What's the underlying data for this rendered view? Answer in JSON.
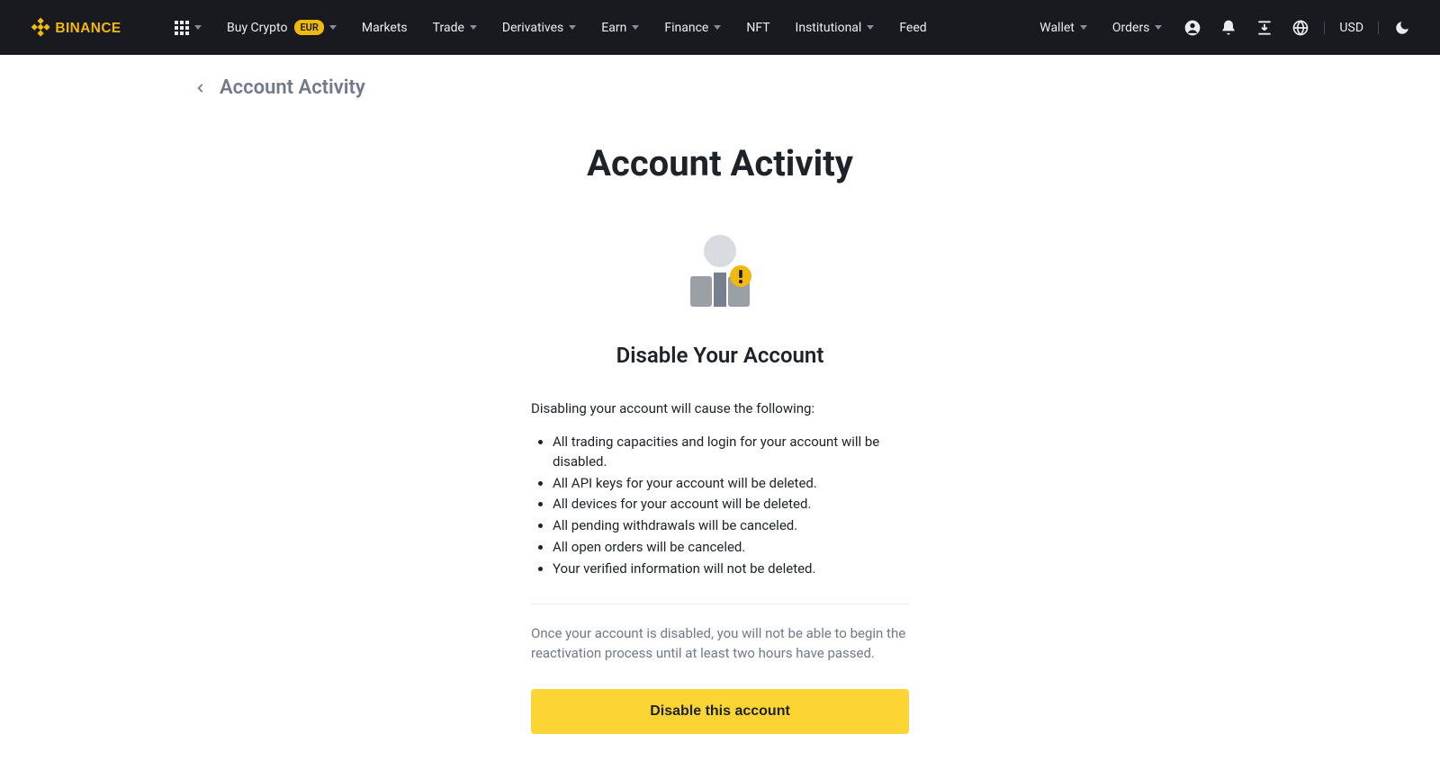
{
  "header": {
    "brand": "BINANCE",
    "nav": {
      "buy_crypto": "Buy Crypto",
      "buy_crypto_badge": "EUR",
      "markets": "Markets",
      "trade": "Trade",
      "derivatives": "Derivatives",
      "earn": "Earn",
      "finance": "Finance",
      "nft": "NFT",
      "institutional": "Institutional",
      "feed": "Feed"
    },
    "right": {
      "wallet": "Wallet",
      "orders": "Orders",
      "currency": "USD"
    }
  },
  "breadcrumb": {
    "title": "Account Activity"
  },
  "page": {
    "title": "Account Activity",
    "section_title": "Disable Your Account",
    "intro": "Disabling your account will cause the following:",
    "bullets": [
      "All trading capacities and login for your account will be disabled.",
      "All API keys for your account will be deleted.",
      "All devices for your account will be deleted.",
      "All pending withdrawals will be canceled.",
      "All open orders will be canceled.",
      "Your verified information will not be deleted."
    ],
    "note": "Once your account is disabled, you will not be able to begin the reactivation process until at least two hours have passed.",
    "button": "Disable this account"
  }
}
